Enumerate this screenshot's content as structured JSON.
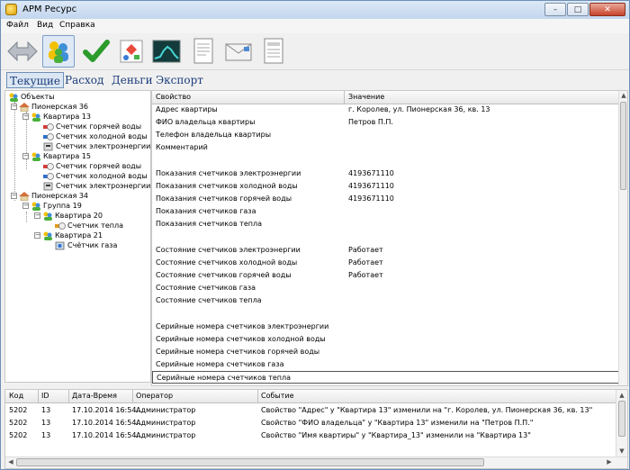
{
  "window": {
    "title": "АРМ Ресурс",
    "controls": [
      "–",
      "□",
      "✕"
    ]
  },
  "menu": [
    "Файл",
    "Вид",
    "Справка"
  ],
  "toolbar": [
    "arrows-icon",
    "objects-icon",
    "checkmark-icon",
    "diagram-icon",
    "chart-icon",
    "document-icon",
    "letter-icon",
    "report-icon"
  ],
  "tabs": [
    "Текущие",
    "Расход",
    "Деньги",
    "Экспорт"
  ],
  "tree": {
    "root": "Объекты",
    "nodes": [
      "Пионерская 36",
      "Квартира 13",
      "Счетчик горячей воды",
      "Счетчик холодной воды",
      "Счетчик электроэнергии",
      "Квартира 15",
      "Счетчик горячей воды",
      "Счетчик холодной воды",
      "Счетчик электроэнергии",
      "Пионерская 34",
      "Группа 19",
      "Квартира 20",
      "Счетчик тепла",
      "Квартира 21",
      "Счётчик газа"
    ]
  },
  "properties": {
    "col_property": "Свойство",
    "col_value": "Значение",
    "rows": [
      {
        "k": "Адрес квартиры",
        "v": "г. Королев, ул. Пионерская 36, кв. 13"
      },
      {
        "k": "ФИО владельца квартиры",
        "v": "Петров П.П."
      },
      {
        "k": "Телефон владельца квартиры",
        "v": ""
      },
      {
        "k": "Комментарий",
        "v": ""
      },
      {
        "k": "",
        "v": ""
      },
      {
        "k": "Показания счетчиков электроэнергии",
        "v": "4193671110"
      },
      {
        "k": "Показания счетчиков холодной воды",
        "v": "4193671110"
      },
      {
        "k": "Показания счетчиков горячей воды",
        "v": "4193671110"
      },
      {
        "k": "Показания счетчиков газа",
        "v": ""
      },
      {
        "k": "Показания счетчиков тепла",
        "v": ""
      },
      {
        "k": "",
        "v": ""
      },
      {
        "k": "Состояние счетчиков электроэнергии",
        "v": "Работает"
      },
      {
        "k": "Состояние счетчиков холодной воды",
        "v": "Работает"
      },
      {
        "k": "Состояние счетчиков горячей воды",
        "v": "Работает"
      },
      {
        "k": "Состояние счетчиков газа",
        "v": ""
      },
      {
        "k": "Состояние счетчиков тепла",
        "v": ""
      },
      {
        "k": "",
        "v": ""
      },
      {
        "k": "Серийные номера счетчиков электроэнергии",
        "v": ""
      },
      {
        "k": "Серийные номера счетчиков холодной воды",
        "v": ""
      },
      {
        "k": "Серийные номера счетчиков горячей воды",
        "v": ""
      },
      {
        "k": "Серийные номера счетчиков газа",
        "v": ""
      },
      {
        "k": "Серийные номера счетчиков тепла",
        "v": ""
      }
    ]
  },
  "log": {
    "columns": [
      "Код",
      "ID",
      "Дата-Время",
      "Оператор",
      "Событие"
    ],
    "rows": [
      [
        "5202",
        "13",
        "17.10.2014 16:54...",
        "Администратор",
        "Свойство \"Адрес\" у \"Квартира 13\" изменили на \"г. Королев, ул. Пионерская 36, кв. 13\""
      ],
      [
        "5202",
        "13",
        "17.10.2014 16:54...",
        "Администратор",
        "Свойство \"ФИО владельца\" у \"Квартира 13\" изменили на \"Петров П.П.\""
      ],
      [
        "5202",
        "13",
        "17.10.2014 16:54...",
        "Администратор",
        "Свойство \"Имя квартиры\" у \"Квартира_13\" изменили на \"Квартира 13\""
      ]
    ]
  }
}
